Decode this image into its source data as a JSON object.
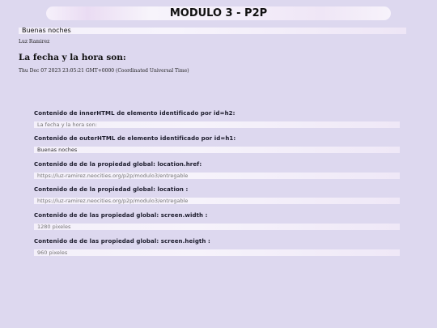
{
  "page": {
    "title": "MODULO 3 - P2P",
    "greeting": "Buenas noches",
    "author": "Luz Ramirez",
    "subheading": "La fecha y la hora son:",
    "datetime": "Thu Dec 07 2023 23:05:21 GMT+0000 (Coordinated Universal Time)"
  },
  "items": [
    {
      "label": "Contenido de innerHTML de elemento identificado por id=h2:",
      "value": "La fecha y la hora son:"
    },
    {
      "label": "Contenido de outerHTML de elemento identificado por id=h1:",
      "value": "Buenas noches"
    },
    {
      "label": "Contenido de de la propiedad global: location.href:",
      "value": "https://luz-ramirez.neocities.org/p2p/modulo3/entregable"
    },
    {
      "label": "Contenido de de la propiedad global: location :",
      "value": "https://luz-ramirez.neocities.org/p2p/modulo3/entregable"
    },
    {
      "label": "Contenido de de las propiedad global: screen.width :",
      "value": "1280 pixeles"
    },
    {
      "label": "Contenido de de las propiedad global: screen.heigth :",
      "value": "960 pixeles"
    }
  ],
  "colors": {
    "background": "#ddd8ef",
    "bar": "#f4f0fa"
  }
}
